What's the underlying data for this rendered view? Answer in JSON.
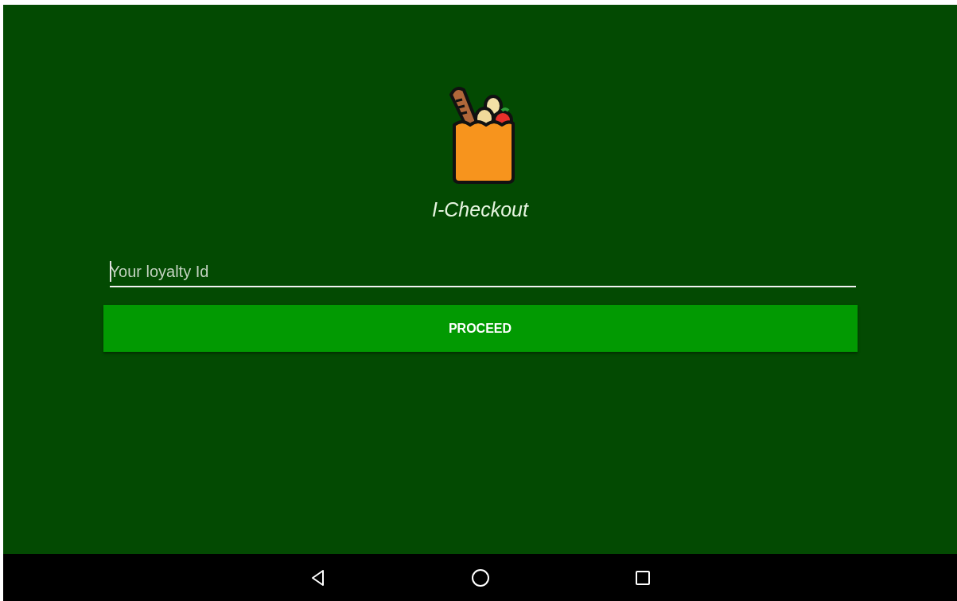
{
  "app": {
    "title": "I-Checkout"
  },
  "loyalty_field": {
    "placeholder": "Your loyalty Id"
  },
  "proceed_button": {
    "label": "PROCEED"
  }
}
